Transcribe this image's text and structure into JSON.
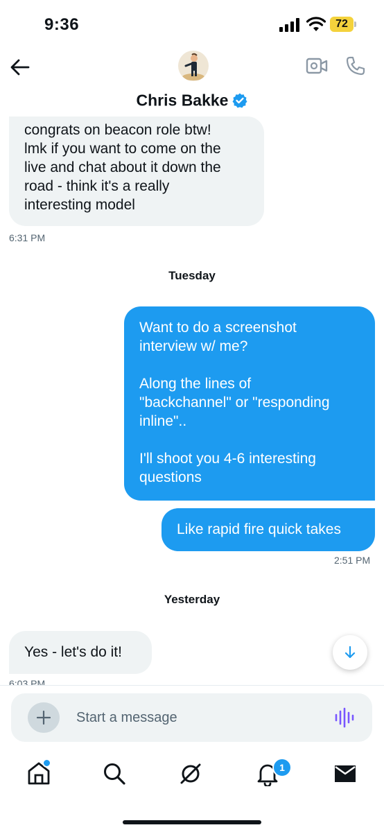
{
  "status_bar": {
    "time": "9:36",
    "battery": "72"
  },
  "header": {
    "contact_name": "Chris Bakke"
  },
  "messages": [
    {
      "direction": "in",
      "lines": [
        "congrats on beacon role btw!",
        "lmk if you want to come on the",
        "live and chat about it down the",
        "road - think it's a really",
        "interesting model"
      ]
    },
    {
      "direction": "out",
      "paragraphs": [
        [
          "Want to do a screenshot",
          "interview w/ me?"
        ],
        [
          "Along the lines of",
          "\"backchannel\" or \"responding",
          "inline\".."
        ],
        [
          "I'll shoot you 4-6 interesting",
          "questions"
        ]
      ]
    },
    {
      "direction": "out",
      "text": "Like rapid fire quick takes"
    },
    {
      "direction": "in",
      "text": "Yes - let's do it!"
    }
  ],
  "timestamps": {
    "msg1": "6:31 PM",
    "msg3": "2:51 PM",
    "msg4": "6:03 PM"
  },
  "day_separators": [
    "Tuesday",
    "Yesterday"
  ],
  "composer": {
    "placeholder": "Start a message"
  },
  "tab_bar": {
    "notification_count": "1"
  },
  "colors": {
    "accent": "#1d9bf0",
    "incoming_bubble": "#eff3f4",
    "voice_icon": "#7856ff",
    "battery": "#f4d23c"
  }
}
